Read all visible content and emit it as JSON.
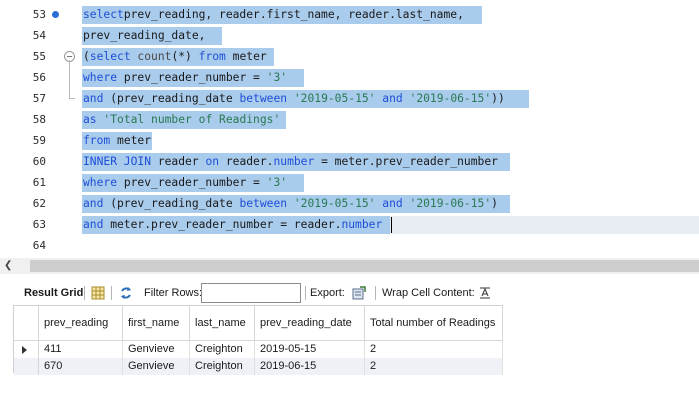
{
  "editor": {
    "lines": [
      {
        "n": "53",
        "tokens": [
          [
            "kw",
            "select"
          ],
          [
            "",
            "prev_reading, reader.first_name, reader.last_name,"
          ]
        ]
      },
      {
        "n": "54",
        "tokens": [
          [
            "",
            "prev_reading_date,"
          ]
        ]
      },
      {
        "n": "55",
        "tokens": [
          [
            "",
            "("
          ],
          [
            "kw",
            "select"
          ],
          [
            "fn",
            " count"
          ],
          [
            "",
            "(*) "
          ],
          [
            "kw",
            "from"
          ],
          [
            "",
            " meter"
          ]
        ]
      },
      {
        "n": "56",
        "tokens": [
          [
            "kw",
            "where"
          ],
          [
            "",
            " prev_reader_number = "
          ],
          [
            "str",
            "'3'"
          ]
        ]
      },
      {
        "n": "57",
        "tokens": [
          [
            "kw",
            "and"
          ],
          [
            "",
            " (prev_reading_date "
          ],
          [
            "kw",
            "between"
          ],
          [
            "",
            " "
          ],
          [
            "str",
            "'2019-05-15'"
          ],
          [
            "",
            " "
          ],
          [
            "kw",
            "and"
          ],
          [
            "",
            " "
          ],
          [
            "str",
            "'2019-06-15'"
          ],
          [
            "",
            "))"
          ]
        ]
      },
      {
        "n": "58",
        "tokens": [
          [
            "kw",
            "as"
          ],
          [
            "",
            " "
          ],
          [
            "str",
            "'Total number of Readings'"
          ]
        ]
      },
      {
        "n": "59",
        "tokens": [
          [
            "kw",
            "from"
          ],
          [
            "",
            " meter"
          ]
        ]
      },
      {
        "n": "60",
        "tokens": [
          [
            "kw",
            "INNER JOIN"
          ],
          [
            "",
            " reader "
          ],
          [
            "kw",
            "on"
          ],
          [
            "",
            " reader."
          ],
          [
            "kw",
            "number"
          ],
          [
            "",
            " = meter.prev_reader_number"
          ]
        ]
      },
      {
        "n": "61",
        "tokens": [
          [
            "kw",
            "where"
          ],
          [
            "",
            " prev_reader_number = "
          ],
          [
            "str",
            "'3'"
          ]
        ]
      },
      {
        "n": "62",
        "tokens": [
          [
            "kw",
            "and"
          ],
          [
            "",
            " (prev_reading_date "
          ],
          [
            "kw",
            "between"
          ],
          [
            "",
            " "
          ],
          [
            "str",
            "'2019-05-15'"
          ],
          [
            "",
            " "
          ],
          [
            "kw",
            "and"
          ],
          [
            "",
            " "
          ],
          [
            "str",
            "'2019-06-15'"
          ],
          [
            "",
            ")"
          ]
        ]
      },
      {
        "n": "63",
        "tokens": [
          [
            "kw",
            "and"
          ],
          [
            "",
            " meter.prev_reader_number = reader."
          ],
          [
            "kw",
            "number"
          ]
        ]
      },
      {
        "n": "64",
        "tokens": []
      }
    ]
  },
  "toolbar": {
    "result_grid_label": "Result Grid",
    "filter_rows_label": "Filter Rows:",
    "filter_rows_value": "",
    "export_label": "Export:",
    "wrap_label": "Wrap Cell Content:"
  },
  "grid": {
    "headers": [
      "prev_reading",
      "first_name",
      "last_name",
      "prev_reading_date",
      "Total number of Readings"
    ],
    "rows": [
      [
        "411",
        "Genvieve",
        "Creighton",
        "2019-05-15",
        "2"
      ],
      [
        "670",
        "Genvieve",
        "Creighton",
        "2019-06-15",
        "2"
      ]
    ]
  },
  "colors": {
    "selection": "#a9cbec",
    "keyword": "#1f4fd8",
    "string": "#2a7a52"
  }
}
